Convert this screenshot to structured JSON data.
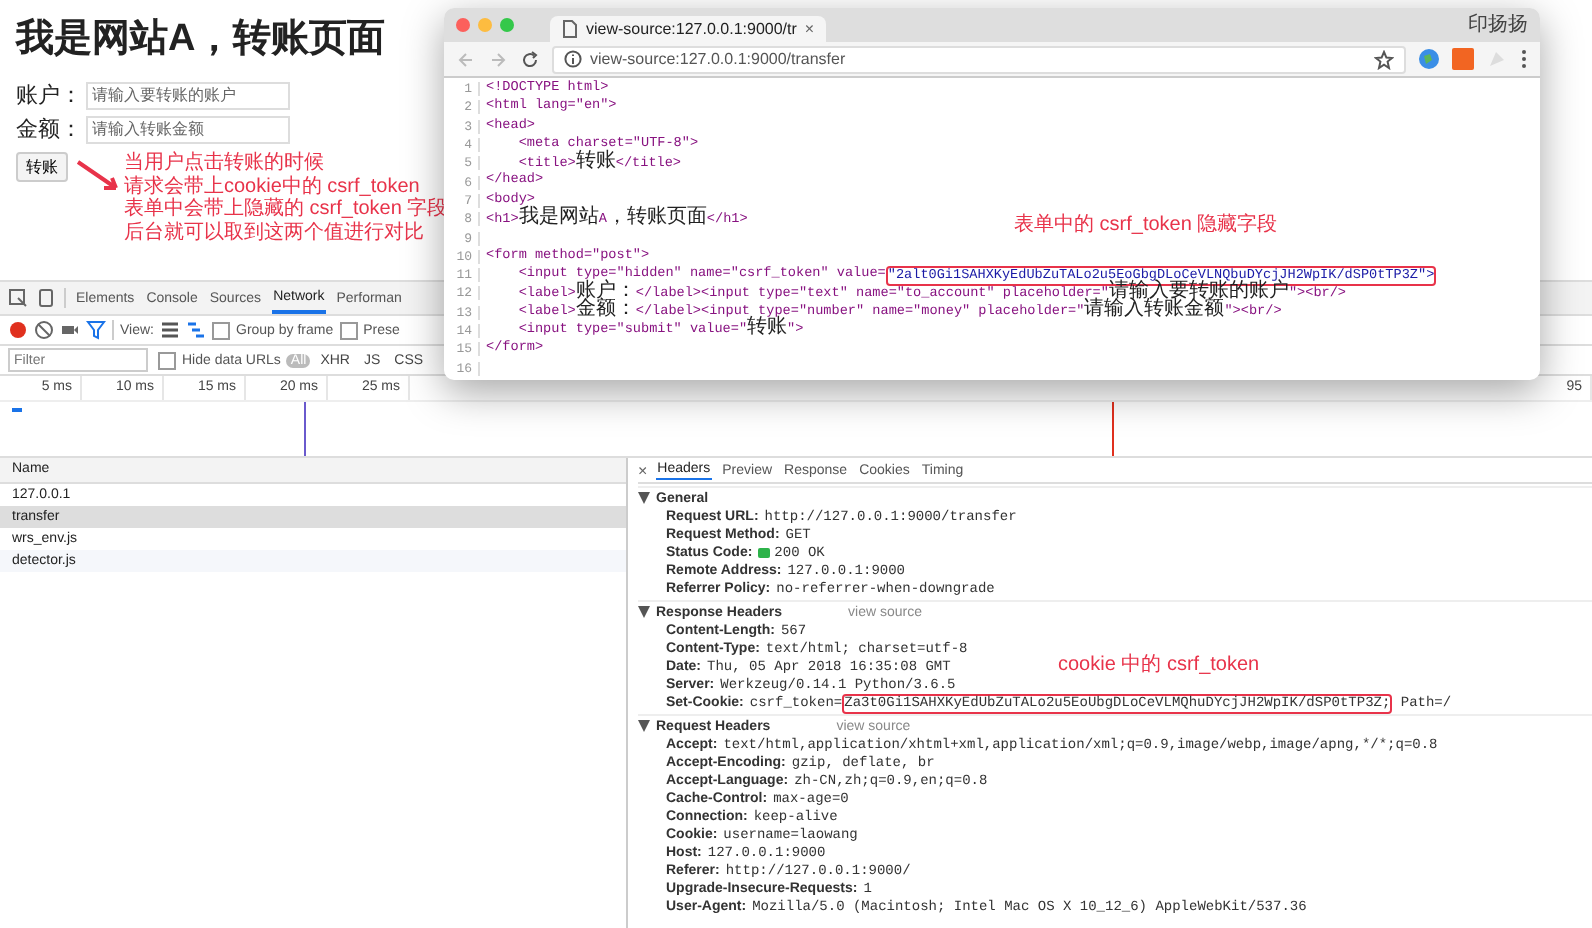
{
  "page": {
    "title": "我是网站A，转账页面",
    "fields": [
      {
        "label": "账户：",
        "placeholder": "请输入要转账的账户"
      },
      {
        "label": "金额：",
        "placeholder": "请输入转账金额"
      }
    ],
    "submit": "转账"
  },
  "note": [
    "当用户点击转账的时候",
    "请求会带上cookie中的 csrf_token",
    "表单中会带上隐藏的 csrf_token 字段",
    "后台就可以取到这两个值进行对比"
  ],
  "devtools": {
    "tabs": [
      {
        "label": "Elements",
        "selected": false
      },
      {
        "label": "Console",
        "selected": false
      },
      {
        "label": "Sources",
        "selected": false
      },
      {
        "label": "Network",
        "selected": true
      },
      {
        "label": "Performan",
        "selected": false
      }
    ],
    "view_label": "View:",
    "options": [
      {
        "label": "Group by frame",
        "checked": false
      },
      {
        "label": "Prese",
        "checked": false
      }
    ],
    "filter_placeholder": "Filter",
    "hide_data_urls": {
      "label": "Hide data URLs",
      "checked": false
    },
    "types": [
      {
        "label": "All",
        "selected": true
      },
      {
        "label": "XHR",
        "selected": false
      },
      {
        "label": "JS",
        "selected": false
      },
      {
        "label": "CSS",
        "selected": false
      }
    ],
    "ticks": [
      "5 ms",
      "10 ms",
      "15 ms",
      "20 ms",
      "25 ms",
      "95"
    ],
    "list_header": "Name",
    "requests": [
      {
        "name": "127.0.0.1",
        "selected": false
      },
      {
        "name": "transfer",
        "selected": true
      },
      {
        "name": "wrs_env.js",
        "selected": false
      },
      {
        "name": "detector.js",
        "selected": false
      }
    ],
    "close": "×",
    "detail_tabs": [
      {
        "label": "Headers",
        "selected": true
      },
      {
        "label": "Preview",
        "selected": false
      },
      {
        "label": "Response",
        "selected": false
      },
      {
        "label": "Cookies",
        "selected": false
      },
      {
        "label": "Timing",
        "selected": false
      }
    ],
    "sections": [
      {
        "title": "General",
        "expanded": true,
        "rows": [
          {
            "kind": "plain",
            "name": "Request URL:",
            "value": "http://127.0.0.1:9000/transfer"
          },
          {
            "kind": "plain",
            "name": "Request Method:",
            "value": "GET"
          },
          {
            "kind": "status",
            "name": "Status Code:",
            "value": "200 OK"
          },
          {
            "kind": "plain",
            "name": "Remote Address:",
            "value": "127.0.0.1:9000"
          },
          {
            "kind": "plain",
            "name": "Referrer Policy:",
            "value": "no-referrer-when-downgrade"
          }
        ]
      },
      {
        "title": "Response Headers",
        "link": "view source",
        "expanded": true,
        "rows": [
          {
            "kind": "plain",
            "name": "Content-Length:",
            "value": "567"
          },
          {
            "kind": "plain",
            "name": "Content-Type:",
            "value": "text/html; charset=utf-8"
          },
          {
            "kind": "plain",
            "name": "Date:",
            "value": "Thu, 05 Apr 2018 16:35:08 GMT"
          },
          {
            "kind": "plain",
            "name": "Server:",
            "value": "Werkzeug/0.14.1 Python/3.6.5"
          },
          {
            "kind": "boxed",
            "name": "Set-Cookie:",
            "value": "csrf_token=",
            "boxed": "Za3t0Gi1SAHXKyEdUbZuTALo2u5EoUbgDLoCeVLMQhuDYcjJH2WpIK/dSP0tTP3Z;",
            "after": " Path=/"
          }
        ]
      },
      {
        "title": "Request Headers",
        "link": "view source",
        "expanded": true,
        "rows": [
          {
            "kind": "plain",
            "name": "Accept:",
            "value": "text/html,application/xhtml+xml,application/xml;q=0.9,image/webp,image/apng,*/*;q=0.8"
          },
          {
            "kind": "plain",
            "name": "Accept-Encoding:",
            "value": "gzip, deflate, br"
          },
          {
            "kind": "plain",
            "name": "Accept-Language:",
            "value": "zh-CN,zh;q=0.9,en;q=0.8"
          },
          {
            "kind": "plain",
            "name": "Cache-Control:",
            "value": "max-age=0"
          },
          {
            "kind": "plain",
            "name": "Connection:",
            "value": "keep-alive"
          },
          {
            "kind": "plain",
            "name": "Cookie:",
            "value": "username=laowang"
          },
          {
            "kind": "plain",
            "name": "Host:",
            "value": "127.0.0.1:9000"
          },
          {
            "kind": "plain",
            "name": "Referer:",
            "value": "http://127.0.0.1:9000/"
          },
          {
            "kind": "plain",
            "name": "Upgrade-Insecure-Requests:",
            "value": "1"
          },
          {
            "kind": "plain",
            "name": "User-Agent:",
            "value": "Mozilla/5.0 (Macintosh; Intel Mac OS X 10_12_6) AppleWebKit/537.36"
          }
        ]
      }
    ],
    "cookie_note": "cookie 中的 csrf_token"
  },
  "source_window": {
    "tab_title": "view-source:127.0.0.1:9000/tr",
    "tab_close": "×",
    "profile": "印扬扬",
    "url": "view-source:127.0.0.1:9000/transfer",
    "lines": [
      {
        "num": "1",
        "text": "<!DOCTYPE html>"
      },
      {
        "num": "2",
        "text": "<html lang=\"en\">"
      },
      {
        "num": "3",
        "text": "<head>"
      },
      {
        "num": "4",
        "text": "    <meta charset=\"UTF-8\">"
      },
      {
        "num": "5",
        "text": "    <title>转账</title>"
      },
      {
        "num": "6",
        "text": "</head>"
      },
      {
        "num": "7",
        "text": "<body>"
      },
      {
        "num": "8",
        "text": "<h1>我是网站A，转账页面</h1>"
      },
      {
        "num": "9"
      },
      {
        "num": "10",
        "text": "<form method=\"post\">"
      },
      {
        "num": "11",
        "text": "    <input type=\"hidden\" name=\"csrf_token\" value=",
        "boxed": "\"2alt0Gi1SAHXKyEdUbZuTALo2u5EoGbgDLoCeVLNQbuDYcjJH2WpIK/dSP0tTP3Z\">"
      },
      {
        "num": "12",
        "text": "    <label>账户：</label><input type=\"text\" name=\"to_account\" placeholder=\"请输入要转账的账户\"><br/>"
      },
      {
        "num": "13",
        "text": "    <label>金额：</label><input type=\"number\" name=\"money\" placeholder=\"请输入转账金额\"><br/>"
      },
      {
        "num": "14",
        "text": "    <input type=\"submit\" value=\"转账\">"
      },
      {
        "num": "15",
        "text": "</form>"
      },
      {
        "num": "16"
      }
    ],
    "note": "表单中的 csrf_token 隐藏字段"
  }
}
